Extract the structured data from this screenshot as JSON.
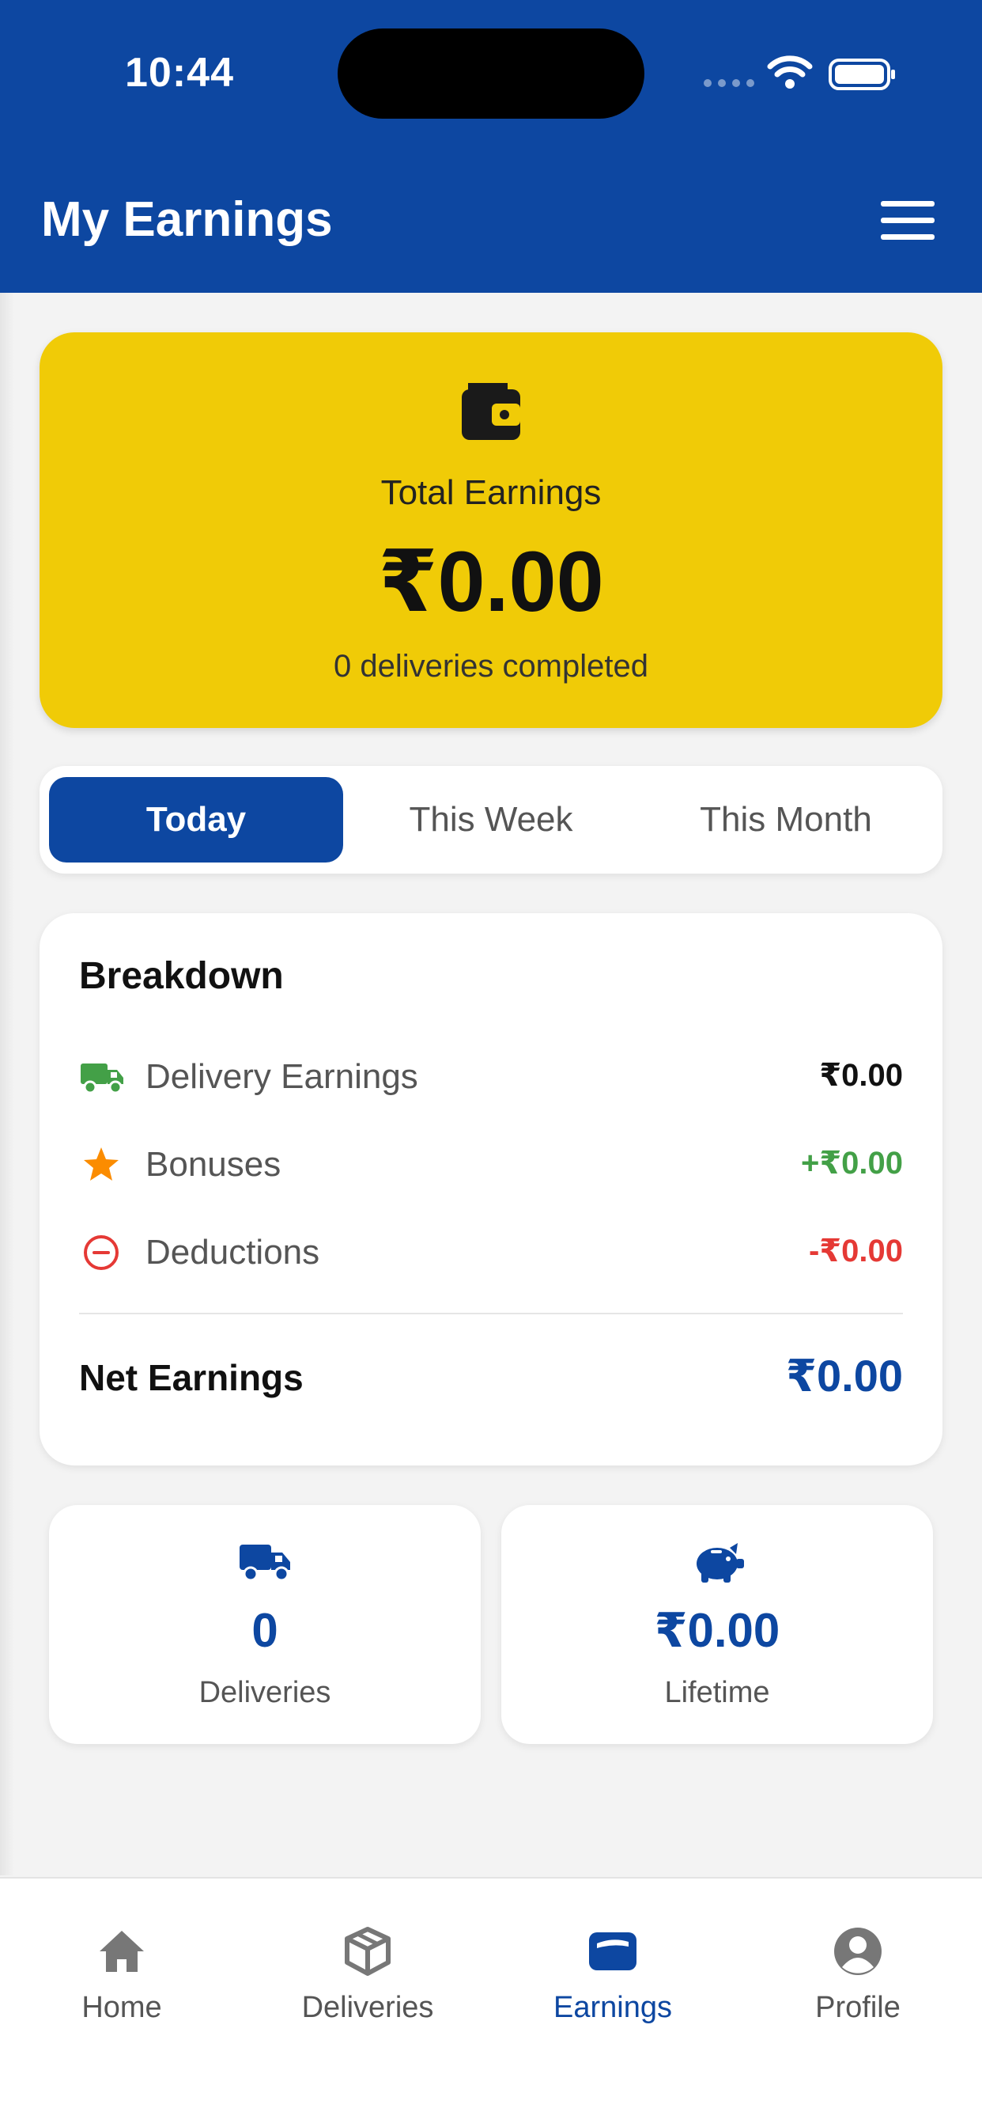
{
  "status_bar": {
    "time": "10:44"
  },
  "header": {
    "title": "My Earnings",
    "menu_icon": "hamburger-menu-icon"
  },
  "summary": {
    "icon": "wallet-icon",
    "label": "Total Earnings",
    "amount": "₹0.00",
    "subtitle": "0 deliveries completed",
    "background": "#f0cb07"
  },
  "period_tabs": [
    {
      "label": "Today",
      "active": true
    },
    {
      "label": "This Week",
      "active": false
    },
    {
      "label": "This Month",
      "active": false
    }
  ],
  "breakdown": {
    "title": "Breakdown",
    "rows": [
      {
        "icon": "truck-icon",
        "label": "Delivery Earnings",
        "value": "₹0.00",
        "color": "#111111"
      },
      {
        "icon": "star-icon",
        "label": "Bonuses",
        "value": "+₹0.00",
        "color": "#43a047"
      },
      {
        "icon": "minus-circle-icon",
        "label": "Deductions",
        "value": "-₹0.00",
        "color": "#e53935"
      }
    ],
    "net_label": "Net Earnings",
    "net_value": "₹0.00"
  },
  "stats": [
    {
      "icon": "truck-icon",
      "value": "0",
      "label": "Deliveries"
    },
    {
      "icon": "piggy-bank-icon",
      "value": "₹0.00",
      "label": "Lifetime"
    }
  ],
  "bottom_nav": [
    {
      "icon": "home-icon",
      "label": "Home",
      "active": false
    },
    {
      "icon": "box-icon",
      "label": "Deliveries",
      "active": false
    },
    {
      "icon": "wallet-icon",
      "label": "Earnings",
      "active": true
    },
    {
      "icon": "user-icon",
      "label": "Profile",
      "active": false
    }
  ],
  "colors": {
    "primary": "#0d47a1",
    "accent": "#f0cb07",
    "positive": "#43a047",
    "negative": "#e53935"
  }
}
